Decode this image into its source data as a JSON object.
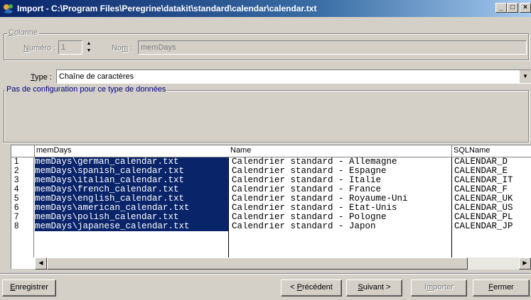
{
  "window": {
    "title": "Import - C:\\Program Files\\Peregrine\\datakit\\standard\\calendar\\calendar.txt",
    "min_glyph": "_",
    "max_glyph": "□",
    "close_glyph": "×"
  },
  "colonne": {
    "group_label_prefix": "",
    "group_label_u": "C",
    "group_label_rest": "olonne",
    "numero_label_u": "N",
    "numero_label_rest": "uméro :",
    "numero_value": "1",
    "nom_label_pre": "No",
    "nom_label_u": "m",
    "nom_label_rest": " :",
    "nom_value": "memDays"
  },
  "type": {
    "label_u": "T",
    "label_rest": "ype :",
    "value": "Chaîne de caractères"
  },
  "config_message": "Pas de configuration pour ce type de données",
  "table": {
    "columns": [
      "memDays",
      "Name",
      "SQLName"
    ],
    "rows": [
      {
        "num": "1",
        "memDays": "memDays\\german_calendar.txt",
        "name": "Calendrier standard - Allemagne",
        "sql": "CALENDAR_D"
      },
      {
        "num": "2",
        "memDays": "memDays\\spanish_calendar.txt",
        "name": "Calendrier standard - Espagne",
        "sql": "CALENDAR_E"
      },
      {
        "num": "3",
        "memDays": "memDays\\italian_calendar.txt",
        "name": "Calendrier standard - Italie",
        "sql": "CALENDAR_IT"
      },
      {
        "num": "4",
        "memDays": "memDays\\french_calendar.txt",
        "name": "Calendrier standard - France",
        "sql": "CALENDAR_F"
      },
      {
        "num": "5",
        "memDays": "memDays\\english_calendar.txt",
        "name": "Calendrier standard - Royaume-Uni",
        "sql": "CALENDAR_UK"
      },
      {
        "num": "6",
        "memDays": "memDays\\american_calendar.txt",
        "name": "Calendrier standard - Etat-Unis",
        "sql": "CALENDAR_US"
      },
      {
        "num": "7",
        "memDays": "memDays\\polish_calendar.txt",
        "name": "Calendrier standard - Pologne",
        "sql": "CALENDAR_PL"
      },
      {
        "num": "8",
        "memDays": "memDays\\japanese_calendar.txt",
        "name": "Calendrier standard - Japon",
        "sql": "CALENDAR_JP"
      }
    ]
  },
  "buttons": {
    "enregistrer_u": "E",
    "enregistrer_rest": "nregistrer",
    "precedent_pre": "< ",
    "precedent_u": "P",
    "precedent_rest": "récédent",
    "suivant_u": "S",
    "suivant_rest": "uivant >",
    "importer_pre": "I",
    "importer_u": "m",
    "importer_rest": "porter",
    "fermer_u": "F",
    "fermer_rest": "ermer"
  },
  "icons": {
    "app": "datakit-app-icon",
    "spin_up": "spin-up-arrow-icon",
    "spin_down": "spin-down-arrow-icon",
    "combo": "combo-dropdown-arrow-icon",
    "scroll_left": "scroll-left-arrow-icon",
    "scroll_right": "scroll-right-arrow-icon"
  },
  "colors": {
    "selection": "#0a246a",
    "titlebar_start": "#0a246a",
    "titlebar_end": "#a6caf0",
    "face": "#d4d0c8"
  }
}
